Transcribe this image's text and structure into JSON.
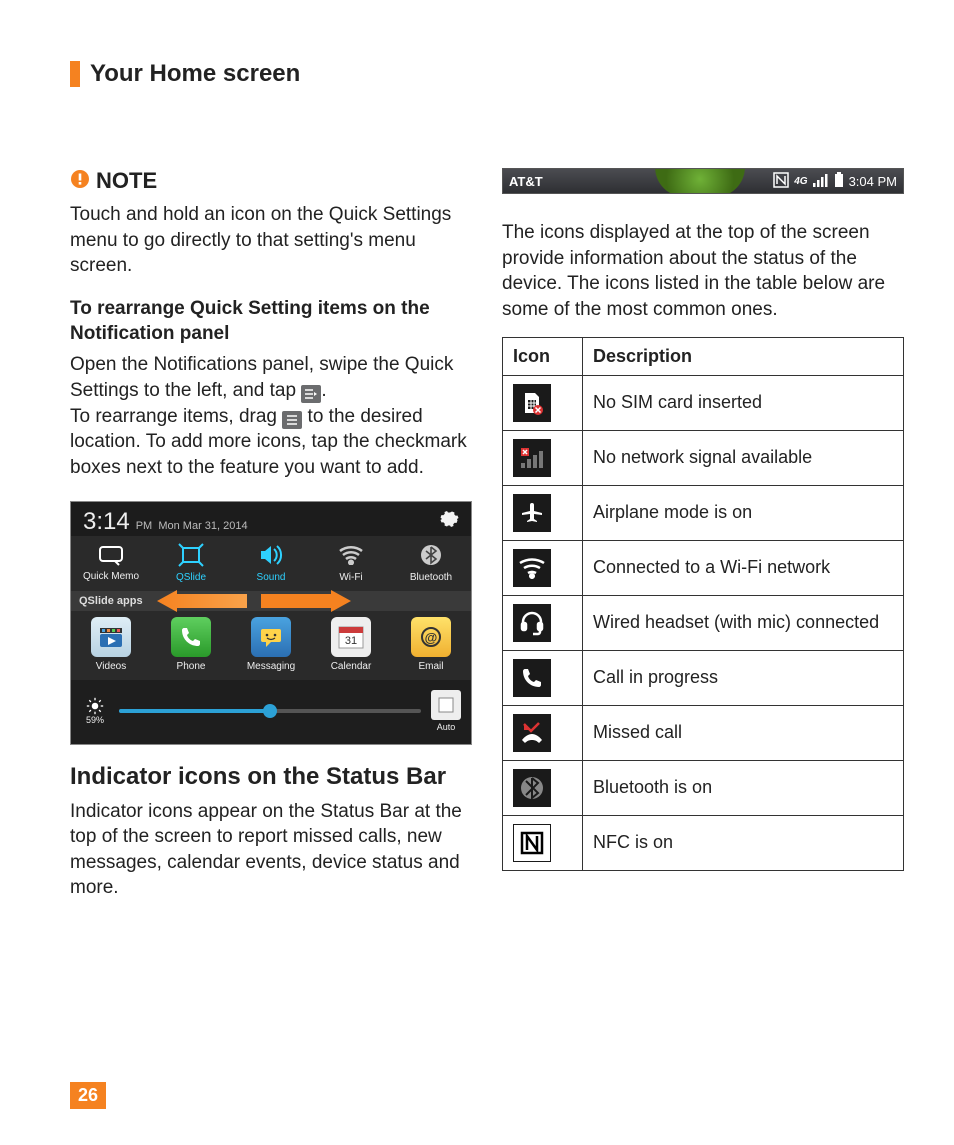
{
  "page": {
    "section_title": "Your Home screen",
    "number": "26"
  },
  "note": {
    "label": "NOTE",
    "body": "Touch and hold an icon on the Quick Settings menu to go directly to that setting's menu screen."
  },
  "rearr": {
    "header": "To rearrange Quick Setting items on the Notification panel",
    "p1a": "Open the Notifications panel, swipe the Quick Settings to the left, and tap ",
    "p1b": ".",
    "p2a": "To rearrange items, drag ",
    "p2b": " to the desired location. To add more icons, tap the checkmark boxes next to the feature you want to add."
  },
  "panel": {
    "time": "3:14",
    "ampm": "PM",
    "date": "Mon Mar 31, 2014",
    "qs": [
      "Quick Memo",
      "QSlide",
      "Sound",
      "Wi-Fi",
      "Bluetooth"
    ],
    "section": "QSlide apps",
    "apps": [
      "Videos",
      "Phone",
      "Messaging",
      "Calendar",
      "Email"
    ],
    "brightness": "59%",
    "auto": "Auto"
  },
  "indicator": {
    "header": "Indicator icons on the Status Bar",
    "body": "Indicator icons appear on the Status Bar at the top of the screen to report missed calls, new messages, calendar events, device status and more."
  },
  "statusbar": {
    "carrier": "AT&T",
    "time": "3:04 PM"
  },
  "col2_body": "The icons displayed at the top of the screen provide information about the status of the device. The icons listed in the table below are some of the most common ones.",
  "table": {
    "h1": "Icon",
    "h2": "Description",
    "rows": [
      "No SIM card inserted",
      "No network signal available",
      "Airplane mode is on",
      "Connected to a Wi-Fi network",
      "Wired headset (with mic) connected",
      "Call in progress",
      "Missed call",
      "Bluetooth is on",
      "NFC is on"
    ]
  }
}
